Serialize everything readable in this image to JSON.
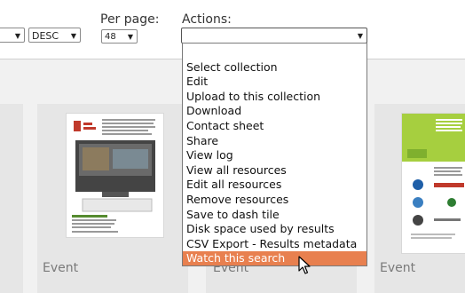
{
  "toolbar": {
    "sort_order": {
      "value": "DESC"
    },
    "per_page": {
      "label": "Per page:",
      "value": "48"
    },
    "actions": {
      "label": "Actions:",
      "value": ""
    }
  },
  "actions_menu": {
    "options": [
      "Select collection",
      "Edit",
      "Upload to this collection",
      "Download",
      "Contact sheet",
      "Share",
      "View log",
      "View all resources",
      "Edit all resources",
      "Remove resources",
      "Save to dash tile",
      "Disk space used by results",
      "CSV Export - Results metadata",
      "Watch this search"
    ],
    "highlighted_option": "Watch this search"
  },
  "results": [
    {
      "label": "Event"
    },
    {
      "label": "Event"
    },
    {
      "label": "Event"
    }
  ],
  "colors": {
    "highlight": "#e8804f",
    "card": "#e6e6e6",
    "background": "#f1f1f1"
  }
}
